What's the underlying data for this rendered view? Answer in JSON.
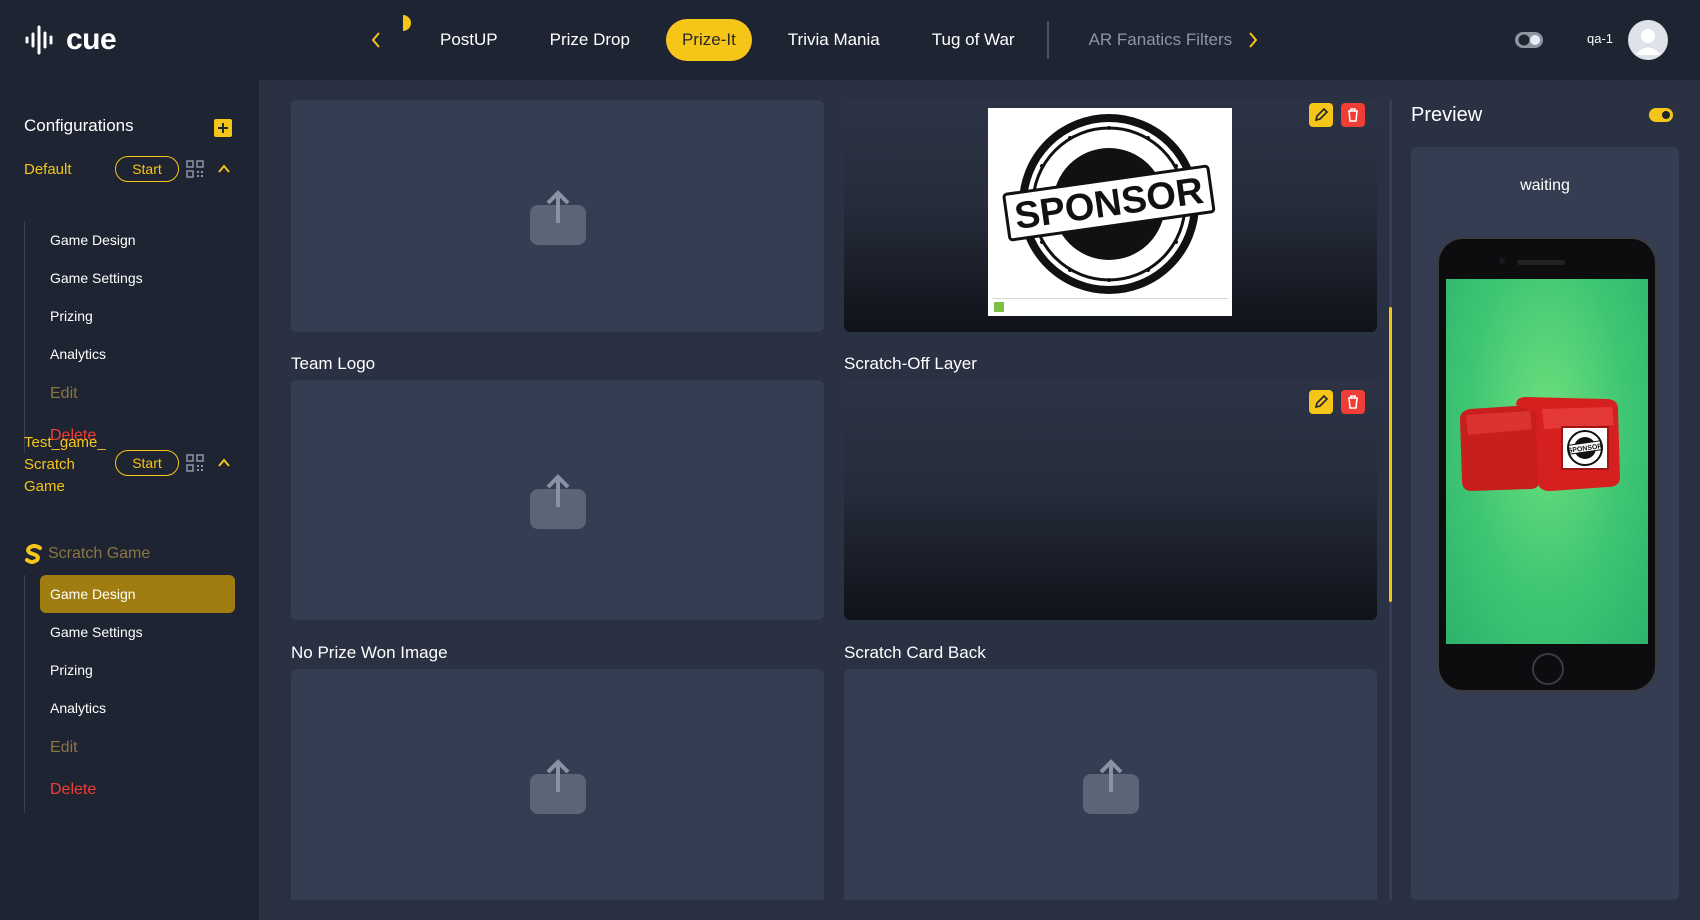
{
  "app": {
    "logo_text": "cue",
    "user_name": "qa-1"
  },
  "nav": {
    "tabs": [
      {
        "label": "PostUP",
        "state": "normal"
      },
      {
        "label": "Prize Drop",
        "state": "normal"
      },
      {
        "label": "Prize-It",
        "state": "active"
      },
      {
        "label": "Trivia Mania",
        "state": "normal"
      },
      {
        "label": "Tug of War",
        "state": "normal"
      },
      {
        "label": "AR Fanatics Filters",
        "state": "dim"
      }
    ]
  },
  "sidebar": {
    "title": "Configurations",
    "games": [
      {
        "name": "Default",
        "start_label": "Start",
        "items": [
          "Game Design",
          "Game Settings",
          "Prizing",
          "Analytics"
        ],
        "edit_label": "Edit",
        "delete_label": "Delete"
      },
      {
        "name_lines": [
          "Test_game_",
          "Scratch",
          "Game"
        ],
        "start_label": "Start",
        "type_label": "Scratch Game",
        "items": [
          "Game Design",
          "Game Settings",
          "Prizing",
          "Analytics"
        ],
        "active_item": "Game Design",
        "edit_label": "Edit",
        "delete_label": "Delete"
      }
    ]
  },
  "main": {
    "cards": [
      {
        "label": "Team Logo"
      },
      {
        "label": "Scratch-Off Layer"
      },
      {
        "label": "No Prize Won Image"
      },
      {
        "label": "Scratch Card Back"
      }
    ],
    "sponsor_image_text": "SPONSOR"
  },
  "preview": {
    "title": "Preview",
    "status": "waiting",
    "sponsor_mini_text": "SPONSOR"
  },
  "colors": {
    "accent": "#f5c518",
    "danger": "#ef3e36",
    "background": "#1e2431",
    "panel": "#2a3142",
    "card": "#343d51"
  },
  "icons": [
    "cue-logo-icon",
    "chevron-left-icon",
    "chevron-right-icon",
    "theme-toggle-icon",
    "user-avatar-icon",
    "plus-icon",
    "qr-code-icon",
    "chevron-up-icon",
    "scratch-s-icon",
    "upload-icon",
    "pencil-icon",
    "trash-icon",
    "toggle-icon"
  ]
}
